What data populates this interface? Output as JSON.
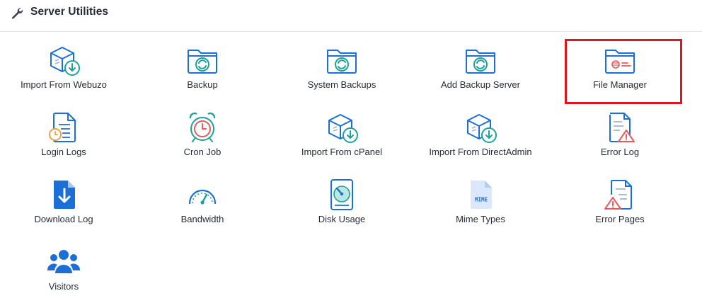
{
  "header": {
    "title": "Server Utilities",
    "icon": "wrench-icon"
  },
  "colors": {
    "teal": "#1aa39b",
    "blue": "#1b6fd8",
    "orange": "#f0a040",
    "red": "#e85a5a",
    "highlight": "#e0161c"
  },
  "items": [
    {
      "label": "Import From Webuzo",
      "icon": "import-box-icon"
    },
    {
      "label": "Backup",
      "icon": "folder-sync-icon"
    },
    {
      "label": "System Backups",
      "icon": "folder-sync-icon"
    },
    {
      "label": "Add Backup Server",
      "icon": "folder-sync-icon"
    },
    {
      "label": "File Manager",
      "icon": "folder-icon"
    },
    {
      "label": "Login Logs",
      "icon": "document-clock-icon"
    },
    {
      "label": "Cron Job",
      "icon": "alarm-clock-icon"
    },
    {
      "label": "Import From cPanel",
      "icon": "import-box-icon"
    },
    {
      "label": "Import From DirectAdmin",
      "icon": "import-box-icon"
    },
    {
      "label": "Error Log",
      "icon": "document-warning-icon"
    },
    {
      "label": "Download Log",
      "icon": "download-document-icon"
    },
    {
      "label": "Bandwidth",
      "icon": "gauge-icon"
    },
    {
      "label": "Disk Usage",
      "icon": "hard-disk-icon"
    },
    {
      "label": "Mime Types",
      "icon": "mime-file-icon"
    },
    {
      "label": "Error Pages",
      "icon": "document-warning-icon"
    },
    {
      "label": "Visitors",
      "icon": "users-icon"
    }
  ],
  "mime_text": "MIME"
}
